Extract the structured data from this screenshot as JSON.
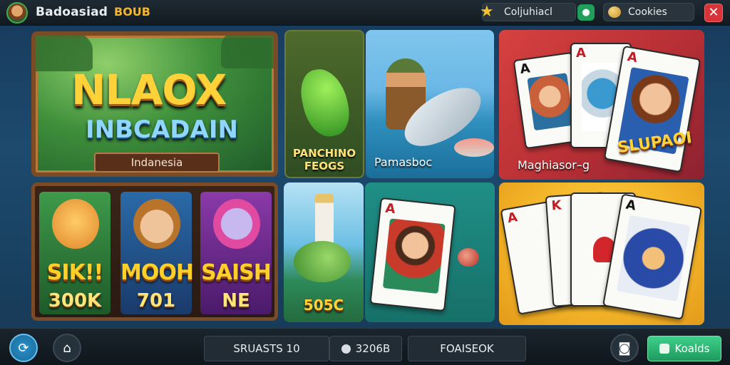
{
  "header": {
    "title": "Badoasiad",
    "badge": "BOUB",
    "pill1_label": "Coljuhiacl",
    "pill2_label": "Cookies",
    "close_symbol": "✕"
  },
  "tiles": {
    "tile1": {
      "title_line1": "NLAOX",
      "title_line2": "INBCADAIN",
      "banner": "Indanesia"
    },
    "tile2": {
      "label_line1": "PANCHINO",
      "label_line2": "FEOGS"
    },
    "tile3": {
      "label": "Pamasboc"
    },
    "tile4": {
      "label": "Maghiasor–g",
      "brand": "SLUPAOI",
      "card_ranks": [
        "A",
        "A",
        "A"
      ]
    },
    "tile5": {
      "characters": [
        {
          "name": "SIK!!",
          "value": "300K"
        },
        {
          "name": "MOOH",
          "value": "701"
        },
        {
          "name": "SAISH",
          "value": "NE"
        }
      ]
    },
    "tile6": {
      "value": "505C"
    },
    "tile7": {
      "card_rank": "A"
    },
    "tile8": {
      "card_ranks": [
        "A",
        "K",
        "A"
      ]
    }
  },
  "footer": {
    "tab1_label": "SRUASTS 10",
    "tab2_label": "3206B",
    "tab3_label": "FOAISEOK",
    "cta_label": "Koalds"
  },
  "colors": {
    "accent_gold": "#ffd23a",
    "close_red": "#d9333a",
    "cta_green": "#1f9a5e"
  },
  "icons": [
    "avatar",
    "star-icon",
    "green-chat-icon",
    "cookie-icon",
    "close-icon",
    "sync-icon",
    "home-icon",
    "gamepad-icon",
    "shield-icon",
    "coin-icon"
  ]
}
